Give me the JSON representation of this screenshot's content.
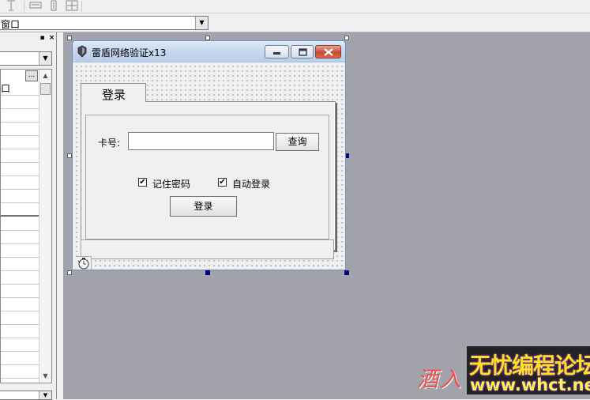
{
  "ide": {
    "toolbar": {
      "icons": [
        "align-top-icon",
        "same-width-icon",
        "same-height-icon",
        "same-size-icon"
      ]
    },
    "window_combo": {
      "value": "窗口"
    },
    "property_panel": {
      "rows": [
        "口"
      ],
      "ellipsis_label": "..."
    }
  },
  "form": {
    "title": "雷盾网络验证x13",
    "tabs": [
      {
        "label": "登录"
      }
    ],
    "card_label": "卡号:",
    "card_input_value": "",
    "query_button": "查询",
    "remember_password": {
      "label": "记住密码",
      "checked": true
    },
    "auto_login": {
      "label": "自动登录",
      "checked": true
    },
    "login_button": "登录",
    "status_text": ""
  },
  "watermark": {
    "script_text": "酒入",
    "title": "无忧编程论坛",
    "url": "www.whct.net"
  },
  "colors": {
    "canvas": "#a2a2aa",
    "title_bar": "#c3d6ee",
    "close_button": "#c94c34",
    "watermark_text": "#ffe020"
  }
}
